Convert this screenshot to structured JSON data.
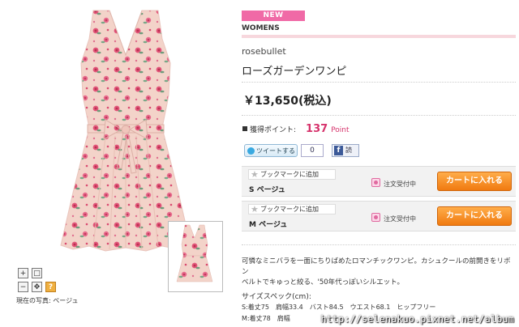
{
  "product": {
    "badge": "NEW",
    "category": "WOMENS",
    "brand": "rosebullet",
    "title": "ローズガーデンワンピ",
    "price": "￥13,650(税込)",
    "points_label": "獲得ポイント:",
    "points_value": "137",
    "points_unit": "Point"
  },
  "social": {
    "tweet_label": "ツイートする",
    "tweet_count": "0",
    "fb_label": "読"
  },
  "sizes": [
    {
      "bookmark_label": "ブックマークに追加",
      "size_label": "S ページュ",
      "status": "注文受付中",
      "cart_label": "カートに入れる"
    },
    {
      "bookmark_label": "ブックマークに追加",
      "size_label": "M ページュ",
      "status": "注文受付中",
      "cart_label": "カートに入れる"
    }
  ],
  "description": {
    "line1": "可憐なミニバラを一面にちりばめたロマンチックワンピ。カシュクールの前開きをリボン",
    "line2": "ベルトでキゅっと絞る、'50年代っぽいシルエット。",
    "specs_title": "サイズスペック(cm):",
    "specs_s": "S:着丈75　肩幅33.4　バスト84.5　ウエスト68.1　ヒップフリー",
    "specs_m": "M:着丈78　肩幅"
  },
  "viewer": {
    "current_photo": "現在の写真: ページュ",
    "help": "?"
  },
  "watermark": "http://selenakuo.pixnet.net/album",
  "colors": {
    "accent_pink": "#f06aa6",
    "cart_orange": "#f07a10",
    "points_pink": "#d6336c"
  }
}
